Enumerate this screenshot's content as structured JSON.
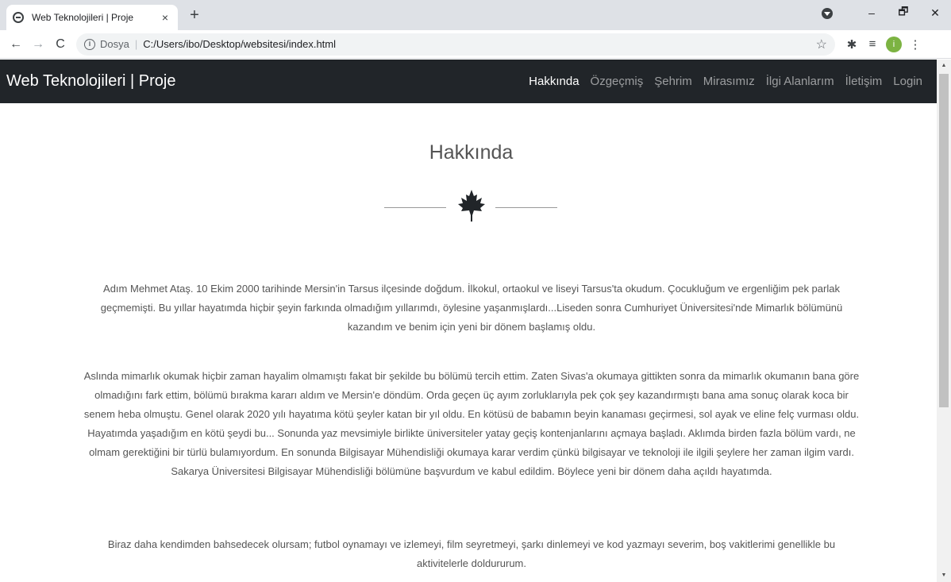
{
  "browser": {
    "tab_title": "Web Teknolojileri | Proje",
    "tab_close": "×",
    "new_tab": "+",
    "window_controls": [
      "–",
      "🗗",
      "✕"
    ],
    "nav": {
      "back": "←",
      "forward": "→",
      "reload": "C"
    },
    "address": {
      "scheme": "Dosya",
      "path": "C:/Users/ibo/Desktop/websitesi/index.html"
    },
    "profile_initial": "i",
    "toolbar_icons": [
      "star-icon",
      "extensions-icon",
      "reading-list-icon",
      "profile-avatar",
      "menu-icon"
    ]
  },
  "site": {
    "brand": "Web Teknolojileri | Proje",
    "nav": [
      {
        "label": "Hakkında",
        "active": true
      },
      {
        "label": "Özgeçmiş",
        "active": false
      },
      {
        "label": "Şehrim",
        "active": false
      },
      {
        "label": "Mirasımız",
        "active": false
      },
      {
        "label": "İlgi Alanlarım",
        "active": false
      },
      {
        "label": "İletişim",
        "active": false
      },
      {
        "label": "Login",
        "active": false
      }
    ],
    "section_title": "Hakkında",
    "divider_icon": "maple-leaf-icon",
    "paragraphs": [
      "Adım Mehmet Ataş. 10 Ekim 2000 tarihinde Mersin'in Tarsus ilçesinde doğdum. İlkokul, ortaokul ve liseyi Tarsus'ta okudum. Çocukluğum ve ergenliğim pek parlak geçmemişti. Bu yıllar hayatımda hiçbir şeyin farkında olmadığım yıllarımdı, öylesine yaşanmışlardı...Liseden sonra Cumhuriyet Üniversitesi'nde Mimarlık bölümünü kazandım ve benim için yeni bir dönem başlamış oldu.",
      "Aslında mimarlık okumak hiçbir zaman hayalim olmamıştı fakat bir şekilde bu bölümü tercih ettim. Zaten Sivas'a okumaya gittikten sonra da mimarlık okumanın bana göre olmadığını fark ettim, bölümü bırakma kararı aldım ve Mersin'e döndüm. Orda geçen üç ayım zorluklarıyla pek çok şey kazandırmıştı bana ama sonuç olarak koca bir senem heba olmuştu. Genel olarak 2020 yılı hayatıma kötü şeyler katan bir yıl oldu. En kötüsü de babamın beyin kanaması geçirmesi, sol ayak ve eline felç vurması oldu. Hayatımda yaşadığım en kötü şeydi bu... Sonunda yaz mevsimiyle birlikte üniversiteler yatay geçiş kontenjanlarını açmaya başladı. Aklımda birden fazla bölüm vardı, ne olmam gerektiğini bir türlü bulamıyordum. En sonunda Bilgisayar Mühendisliği okumaya karar verdim çünkü bilgisayar ve teknoloji ile ilgili şeylere her zaman ilgim vardı. Sakarya Üniversitesi Bilgisayar Mühendisliği bölümüne başvurdum ve kabul edildim. Böylece yeni bir dönem daha açıldı hayatımda.",
      "Biraz daha kendimden bahsedecek olursam; futbol oynamayı ve izlemeyi, film seyretmeyi, şarkı dinlemeyi ve kod yazmayı severim, boş vakitlerimi genellikle bu aktivitelerle doldururum."
    ]
  }
}
